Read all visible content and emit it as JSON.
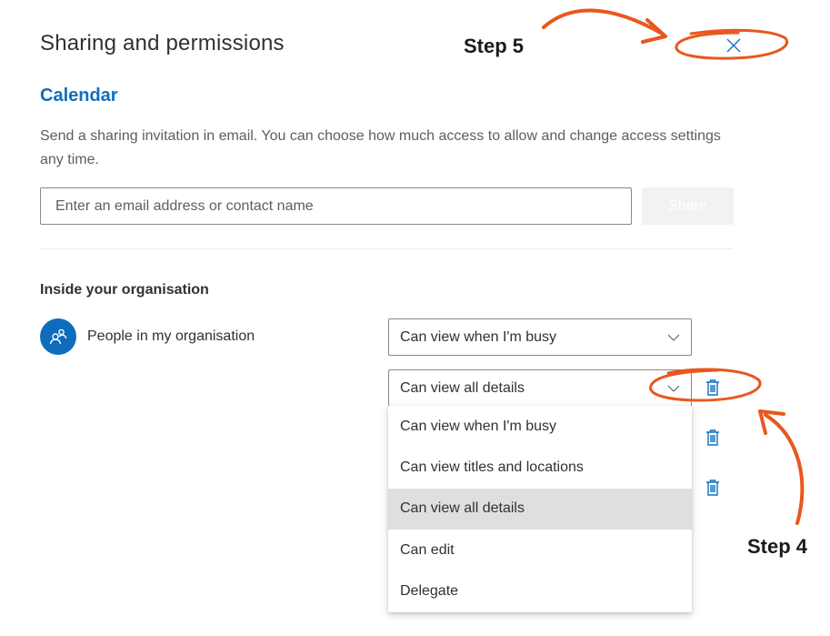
{
  "panel": {
    "title": "Sharing and permissions",
    "section_title": "Calendar",
    "description": "Send a sharing invitation in email. You can choose how much access to allow and change access settings any time."
  },
  "invite": {
    "placeholder": "Enter an email address or contact name",
    "share_label": "Share"
  },
  "organisation": {
    "heading": "Inside your organisation",
    "people": [
      {
        "name": "People in my organisation",
        "permission": "Can view when I'm busy"
      }
    ],
    "second_permission": "Can view all details"
  },
  "permission_menu": {
    "options": [
      "Can view when I'm busy",
      "Can view titles and locations",
      "Can view all details",
      "Can edit",
      "Delegate"
    ],
    "selected": "Can view all details"
  },
  "annotations": {
    "step4": "Step 4",
    "step5": "Step 5",
    "color": "#e8581e"
  },
  "colors": {
    "accent": "#106ebe",
    "avatar": "#0f6cbd",
    "selected_bg": "#e1dfdd"
  }
}
